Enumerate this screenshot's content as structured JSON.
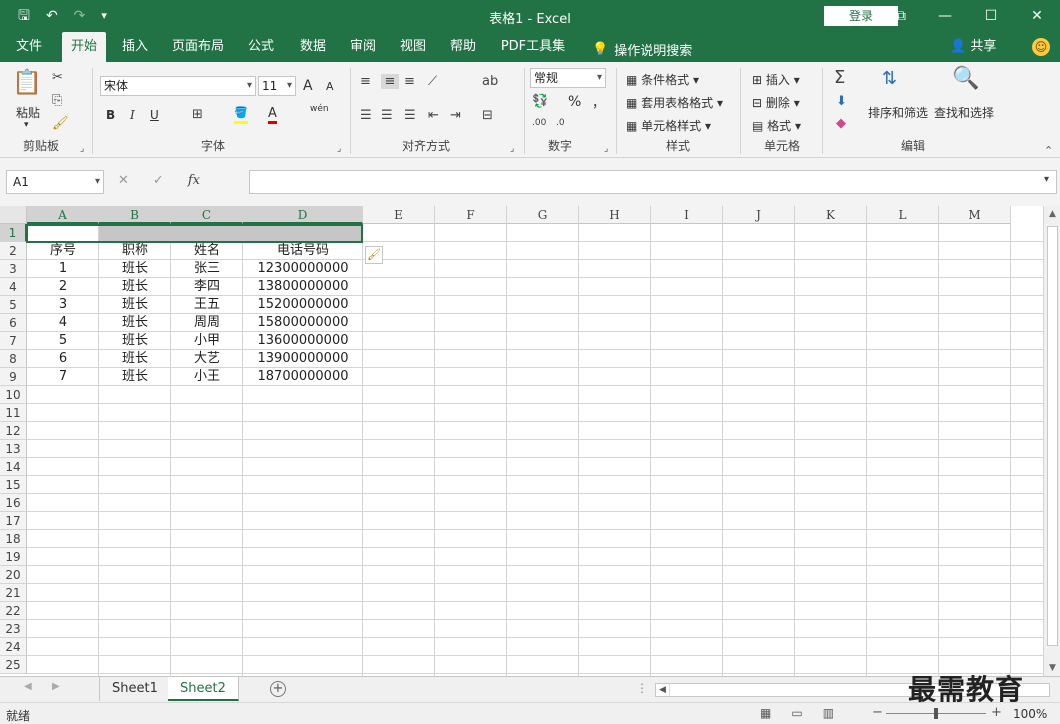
{
  "titlebar": {
    "title": "表格1  -  Excel",
    "login": "登录",
    "qat": {
      "save": "🖫",
      "undo": "↶",
      "redo": "↷",
      "customize": "▾"
    },
    "win": {
      "ribbon_opts": "⧉",
      "minimize": "—",
      "maximize": "☐",
      "close": "✕"
    }
  },
  "tabs": [
    {
      "label": "文件"
    },
    {
      "label": "开始"
    },
    {
      "label": "插入"
    },
    {
      "label": "页面布局"
    },
    {
      "label": "公式"
    },
    {
      "label": "数据"
    },
    {
      "label": "审阅"
    },
    {
      "label": "视图"
    },
    {
      "label": "帮助"
    },
    {
      "label": "PDF工具集"
    }
  ],
  "tell_me": "操作说明搜索",
  "share": "共享",
  "ribbon": {
    "clipboard": {
      "paste": "粘贴",
      "label": "剪贴板"
    },
    "font": {
      "name": "宋体",
      "size": "11",
      "bold": "B",
      "italic": "I",
      "underline": "U",
      "label": "字体",
      "grow": "A",
      "shrink": "A",
      "wen": "wén"
    },
    "align": {
      "label": "对齐方式"
    },
    "number": {
      "format": "常规",
      "percent": "%",
      "comma": "，",
      "label": "数字"
    },
    "styles": {
      "cond": "条件格式",
      "table": "套用表格格式",
      "cell": "单元格样式",
      "label": "样式"
    },
    "cells": {
      "insert": "插入",
      "delete": "删除",
      "format": "格式",
      "label": "单元格"
    },
    "editing": {
      "sort": "排序和筛选",
      "find": "查找和选择",
      "label": "编辑"
    }
  },
  "formula": {
    "namebox": "A1",
    "cancel": "✕",
    "enter": "✓",
    "fx": "fx",
    "value": ""
  },
  "columns": [
    "A",
    "B",
    "C",
    "D",
    "E",
    "F",
    "G",
    "H",
    "I",
    "J",
    "K",
    "L",
    "M"
  ],
  "rows": [
    "1",
    "2",
    "3",
    "4",
    "5",
    "6",
    "7",
    "8",
    "9",
    "10",
    "11",
    "12",
    "13",
    "14",
    "15",
    "16",
    "17",
    "18",
    "19",
    "20",
    "21",
    "22",
    "23",
    "24",
    "25"
  ],
  "table": {
    "header": [
      "序号",
      "职称",
      "姓名",
      "电话号码"
    ],
    "data": [
      [
        "1",
        "班长",
        "张三",
        "12300000000"
      ],
      [
        "2",
        "班长",
        "李四",
        "13800000000"
      ],
      [
        "3",
        "班长",
        "王五",
        "15200000000"
      ],
      [
        "4",
        "班长",
        "周周",
        "15800000000"
      ],
      [
        "5",
        "班长",
        "小甲",
        "13600000000"
      ],
      [
        "6",
        "班长",
        "大艺",
        "13900000000"
      ],
      [
        "7",
        "班长",
        "小王",
        "18700000000"
      ]
    ]
  },
  "sheets": [
    {
      "label": "Sheet1"
    },
    {
      "label": "Sheet2"
    }
  ],
  "status": {
    "ready": "就绪",
    "zoom": "100%",
    "minus": "−",
    "plus": "+"
  },
  "watermark": "最需教育",
  "colors": {
    "accent": "#217346"
  }
}
